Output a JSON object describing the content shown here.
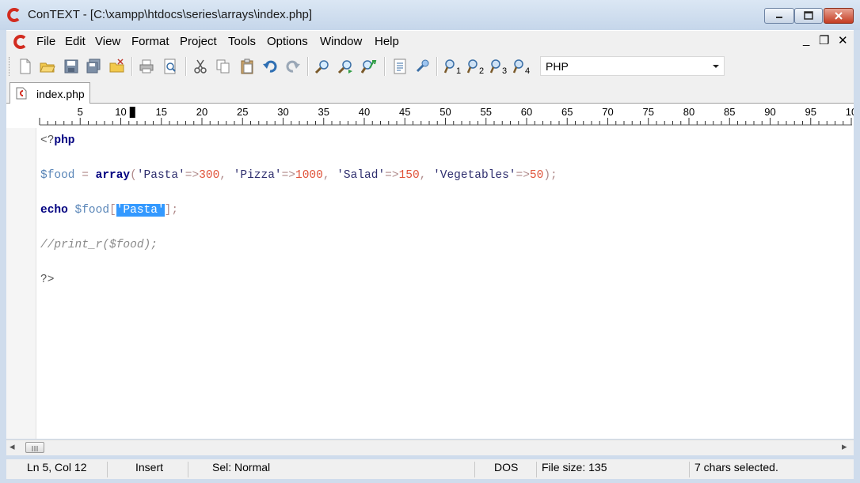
{
  "window": {
    "title": "ConTEXT - [C:\\xampp\\htdocs\\series\\arrays\\index.php]"
  },
  "menu": [
    "File",
    "Edit",
    "View",
    "Format",
    "Project",
    "Tools",
    "Options",
    "Window",
    "Help"
  ],
  "mdi_controls": {
    "minimize": "_",
    "restore": "❐",
    "close": "✕"
  },
  "toolbar": {
    "highlighter_value": "PHP",
    "user_cmd_subscripts": [
      "1",
      "2",
      "3",
      "4"
    ]
  },
  "tabs": [
    {
      "label": "index.php"
    }
  ],
  "ruler": {
    "labels": [
      "5",
      "10",
      "15",
      "20",
      "25",
      "30",
      "35",
      "40",
      "45",
      "50",
      "55",
      "60",
      "65",
      "70",
      "75",
      "80",
      "85",
      "90",
      "95",
      "10"
    ]
  },
  "editor": {
    "lines": [
      [
        {
          "t": "<?",
          "c": "t-plain"
        },
        {
          "t": "php",
          "c": "t-kw"
        }
      ],
      [],
      [
        {
          "t": "$food",
          "c": "t-var"
        },
        {
          "t": " = ",
          "c": "t-op"
        },
        {
          "t": "array",
          "c": "t-kw"
        },
        {
          "t": "(",
          "c": "t-op"
        },
        {
          "t": "'Pasta'",
          "c": "t-str"
        },
        {
          "t": "=>",
          "c": "t-op"
        },
        {
          "t": "300",
          "c": "t-num"
        },
        {
          "t": ", ",
          "c": "t-op"
        },
        {
          "t": "'Pizza'",
          "c": "t-str"
        },
        {
          "t": "=>",
          "c": "t-op"
        },
        {
          "t": "1000",
          "c": "t-num"
        },
        {
          "t": ", ",
          "c": "t-op"
        },
        {
          "t": "'Salad'",
          "c": "t-str"
        },
        {
          "t": "=>",
          "c": "t-op"
        },
        {
          "t": "150",
          "c": "t-num"
        },
        {
          "t": ", ",
          "c": "t-op"
        },
        {
          "t": "'Vegetables'",
          "c": "t-str"
        },
        {
          "t": "=>",
          "c": "t-op"
        },
        {
          "t": "50",
          "c": "t-num"
        },
        {
          "t": ");",
          "c": "t-op"
        }
      ],
      [],
      [
        {
          "t": "echo",
          "c": "t-kw"
        },
        {
          "t": " ",
          "c": "t-op"
        },
        {
          "t": "$food",
          "c": "t-var"
        },
        {
          "t": "[",
          "c": "t-op"
        },
        {
          "t": "'Pasta'",
          "c": "t-sel"
        },
        {
          "t": "];",
          "c": "t-op"
        }
      ],
      [],
      [
        {
          "t": "//print_r($food);",
          "c": "t-cmt"
        }
      ],
      [],
      [
        {
          "t": "?>",
          "c": "t-plain"
        }
      ]
    ]
  },
  "scrollbar": {
    "left_arrow": "◂",
    "right_arrow": "▸"
  },
  "status": {
    "position": "Ln 5, Col 12",
    "mode": "Insert",
    "selection_mode": "Sel: Normal",
    "line_endings": "DOS",
    "file_size": "File size: 135",
    "selected_info": "7 chars selected."
  }
}
